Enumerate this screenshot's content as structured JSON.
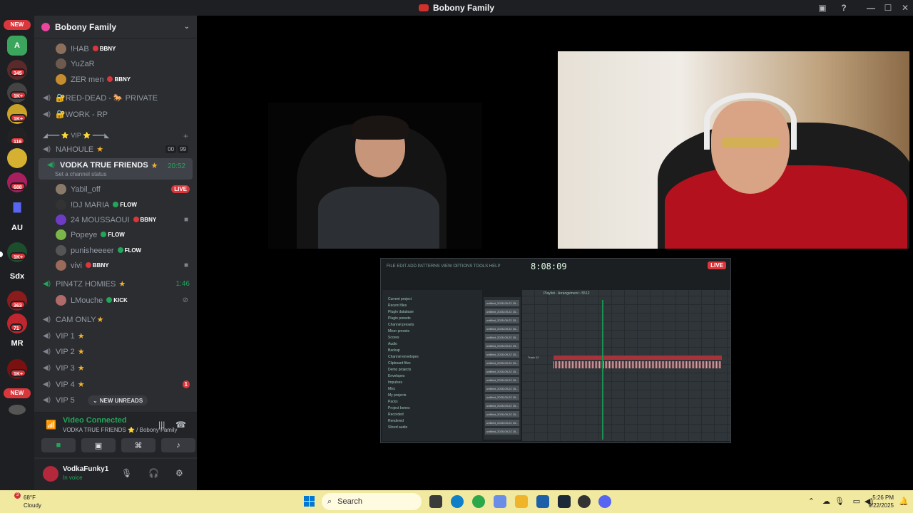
{
  "window": {
    "title": "Bobony Family"
  },
  "rail": {
    "new_top": "NEW",
    "new_bottom": "NEW",
    "badges": [
      "345",
      "1K+",
      "1K+",
      "116",
      "688",
      "1K+",
      "363",
      "71",
      "1K+"
    ],
    "text_servers": [
      "AU",
      "Sdx",
      "MR"
    ]
  },
  "guild": {
    "name": "Bobony Family"
  },
  "members_top": [
    {
      "name": "!HAB",
      "tag": "BBNY"
    },
    {
      "name": "YuZaR",
      "tag": ""
    },
    {
      "name": "ZER men",
      "tag": "BBNY"
    }
  ],
  "channels": {
    "red_dead": "🔐RED-DEAD - 🐎 PRIVATE",
    "work": "🔐WORK - RP",
    "vip_category": "◢━━━ ⭐ VIP ⭐ ━━━◣",
    "nahoule": "NAHOULE",
    "nahoule_counts": [
      "00",
      "99"
    ],
    "vodka": "VODKA TRUE FRIENDS",
    "vodka_timer": "20:52",
    "vodka_status": "Set a channel status",
    "pin4tz": "PIN4TZ HOMIES",
    "pin4tz_timer": "1:46",
    "cam_only": "CAM ONLY",
    "vip1": "VIP 1",
    "vip2": "VIP 2",
    "vip3": "VIP 3",
    "vip4": "VIP 4",
    "vip4_badge": "1",
    "vip5": "VIP 5"
  },
  "vodka_members": [
    {
      "name": "Yabil_off",
      "tag": "",
      "live": "LIVE"
    },
    {
      "name": "!DJ MARIA",
      "tag": "FLOW"
    },
    {
      "name": "24 MOUSSAOUI",
      "tag": "BBNY"
    },
    {
      "name": "Popeye",
      "tag": "FLOW"
    },
    {
      "name": "punisheeeer",
      "tag": "FLOW"
    },
    {
      "name": "vivi",
      "tag": "BBNY"
    }
  ],
  "pin4tz_members": [
    {
      "name": "LMouche",
      "tag": "KICK"
    }
  ],
  "new_unreads": "NEW UNREADS",
  "voice_panel": {
    "title": "Video Connected",
    "subtitle": "VODKA TRUE FRIENDS ⭐ / Bobony Family"
  },
  "user": {
    "name": "VodkaFunky1",
    "status": "In voice"
  },
  "stream": {
    "live_label": "LIVE",
    "fl_menu": "FILE EDIT ADD PATTERNS VIEW OPTIONS TOOLS HELP",
    "fl_time": "8:08:09",
    "fl_browser_items": [
      "Current project",
      "Recent files",
      "Plugin database",
      "Plugin presets",
      "Channel presets",
      "Mixer presets",
      "Scores",
      "Audio",
      "Backup",
      "Channel envelopes",
      "Clipboard files",
      "Demo projects",
      "Envelopes",
      "Impulses",
      "Misc",
      "My projects",
      "Packs",
      "Project bones",
      "Recorded",
      "Rendered",
      "Sliced audio"
    ],
    "fl_clips": [
      "untitled_2025-09-22 15...",
      "untitled_2025-09-22 15...",
      "untitled_2025-09-22 15...",
      "untitled_2025-09-22 15...",
      "untitled_2025-09-22 15...",
      "untitled_2025-09-22 15...",
      "untitled_2025-09-22 15...",
      "untitled_2025-09-22 15...",
      "untitled_2025-09-22 15...",
      "untitled_2025-09-22 15...",
      "untitled_2025-09-22 15...",
      "untitled_2025-09-22 15...",
      "untitled_2025-09-22 15...",
      "untitled_2025-09-22 15...",
      "untitled_2025-09-22 15...",
      "untitled_2025-09-22 15..."
    ],
    "fl_playlist_title": "Playlist - Arrangement › 5512",
    "fl_track": "Track 12"
  },
  "taskbar": {
    "weather_temp": "68°F",
    "weather_desc": "Cloudy",
    "weather_badge": "3",
    "search_label": "Search",
    "time": "5:26 PM",
    "date": "9/22/2025"
  },
  "colors": {
    "accent_green": "#23a55a",
    "danger": "#da373c",
    "taskbar": "#f2e9a0"
  }
}
